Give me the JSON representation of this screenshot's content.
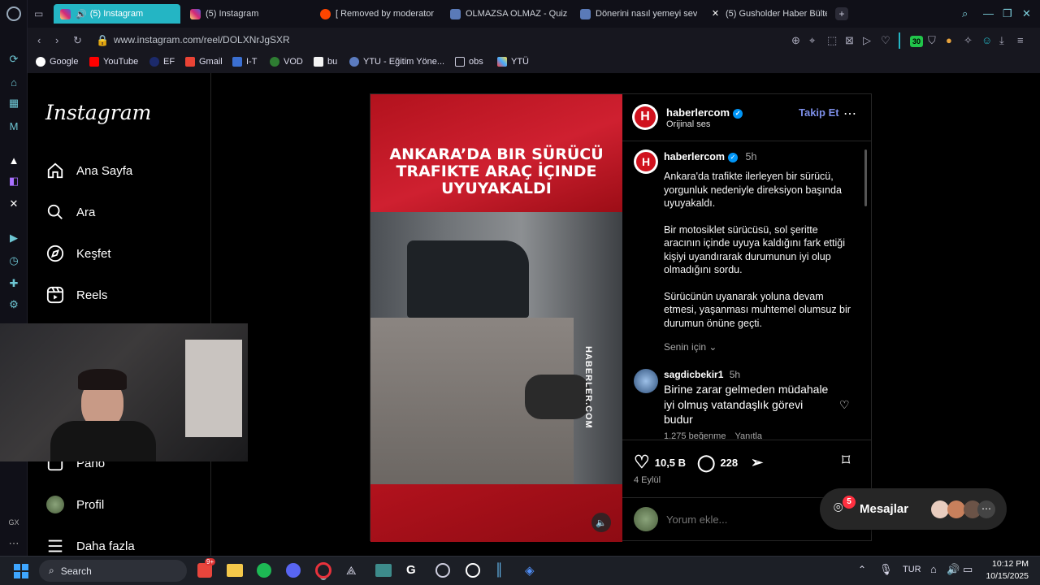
{
  "browser": {
    "tabs": [
      {
        "label": "(5) Instagram",
        "active": true
      },
      {
        "label": "(5) Instagram",
        "active": false
      },
      {
        "label": "[ Removed by moderator ]",
        "active": false
      },
      {
        "label": "OLMAZSA OLMAZ - Quiz",
        "active": false
      },
      {
        "label": "Dönerini nasıl yemeyi sev",
        "active": false
      },
      {
        "label": "(5) Gusholder Haber Bülte",
        "active": false
      }
    ],
    "url": "www.instagram.com/reel/DOLXNrJgSXR",
    "bookmarks": [
      "Google",
      "YouTube",
      "EF",
      "Gmail",
      "I-T",
      "VOD",
      "bu",
      "YTU - Eğitim Yöne...",
      "obs",
      "YTÜ"
    ],
    "extension_badge": "30"
  },
  "instagram": {
    "logo": "Instagram",
    "nav": [
      "Ana Sayfa",
      "Ara",
      "Keşfet",
      "Reels",
      "Pano",
      "Profil",
      "Daha fazla"
    ]
  },
  "post": {
    "headline": "ANKARA’DA BIR SÜRÜCÜ TRAFIKTE ARAÇ İÇINDE UYUYAKALDI",
    "watermark": "HABERLER.COM",
    "author": "haberlercom",
    "audio": "Orijinal ses",
    "follow": "Takip Et",
    "avatar_letter": "H",
    "caption_time": "5h",
    "caption": [
      "Ankara'da trafikte ilerleyen bir sürücü, yorgunluk nedeniyle direksiyon başında uyuyakaldı.",
      "Bir motosiklet sürücüsü, sol şeritte aracının içinde uyuya kaldığını fark ettiği kişiyi uyandırarak durumunun iyi olup olmadığını sordu.",
      "Sürücünün uyanarak yoluna devam etmesi, yaşanması muhtemel olumsuz bir durumun önüne geçti."
    ],
    "for_you": "Senin için",
    "comment": {
      "user": "sagdicbekir1",
      "time": "5h",
      "text": "Birine zarar gelmeden müdahale iyi olmuş vatandaşlık görevi budur",
      "likes": "1.275 beğenme",
      "reply": "Yanıtla"
    },
    "likes": "10,5 B",
    "comments": "228",
    "date": "4 Eylül",
    "comment_placeholder": "Yorum ekle..."
  },
  "messages": {
    "label": "Mesajlar",
    "badge": "5"
  },
  "taskbar": {
    "search": "Search",
    "lang": "TUR",
    "time": "10:12 PM",
    "date": "10/15/2025",
    "store_badge": "9+"
  }
}
